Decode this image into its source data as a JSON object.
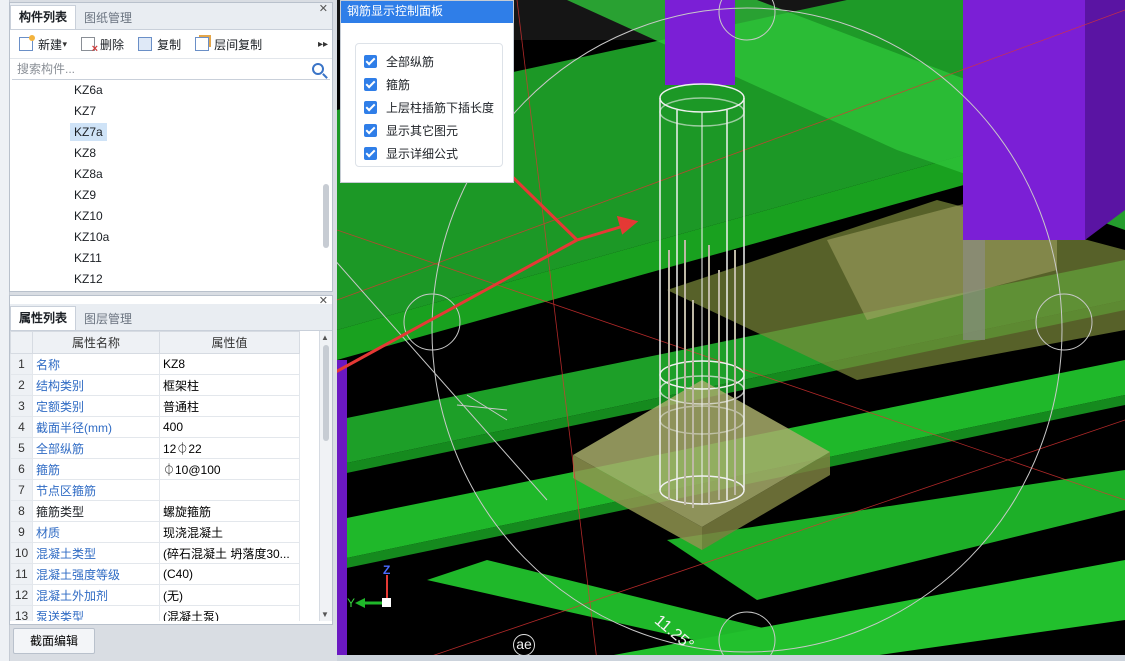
{
  "component_panel": {
    "tabs": [
      "构件列表",
      "图纸管理"
    ],
    "toolbar": {
      "new": "新建",
      "delete": "删除",
      "copy": "复制",
      "floor_copy": "层间复制"
    },
    "search_placeholder": "搜索构件...",
    "items": [
      "KZ6a",
      "KZ7",
      "KZ7a",
      "KZ8",
      "KZ8a",
      "KZ9",
      "KZ10",
      "KZ10a",
      "KZ11",
      "KZ12"
    ],
    "selected_item": "KZ7a"
  },
  "property_panel": {
    "tabs": [
      "属性列表",
      "图层管理"
    ],
    "headers": {
      "name": "属性名称",
      "value": "属性值"
    },
    "rows": [
      {
        "no": "1",
        "name": "名称",
        "value": "KZ8",
        "blue": true
      },
      {
        "no": "2",
        "name": "结构类别",
        "value": "框架柱",
        "blue": true
      },
      {
        "no": "3",
        "name": "定额类别",
        "value": "普通柱",
        "blue": true
      },
      {
        "no": "4",
        "name": "截面半径(mm)",
        "value": "400",
        "blue": true
      },
      {
        "no": "5",
        "name": "全部纵筋",
        "value": "12⏀22",
        "blue": true
      },
      {
        "no": "6",
        "name": "箍筋",
        "value": "⏀10@100",
        "blue": true
      },
      {
        "no": "7",
        "name": "节点区箍筋",
        "value": "",
        "blue": true
      },
      {
        "no": "8",
        "name": "箍筋类型",
        "value": "螺旋箍筋",
        "blue": false
      },
      {
        "no": "9",
        "name": "材质",
        "value": "现浇混凝土",
        "blue": true
      },
      {
        "no": "10",
        "name": "混凝土类型",
        "value": "(碎石混凝土 坍落度30...",
        "blue": true
      },
      {
        "no": "11",
        "name": "混凝土强度等级",
        "value": "(C40)",
        "blue": true
      },
      {
        "no": "12",
        "name": "混凝土外加剂",
        "value": "(无)",
        "blue": true
      },
      {
        "no": "13",
        "name": "泵送类型",
        "value": "(混凝土泵)",
        "blue": true
      }
    ],
    "section_edit_button": "截面编辑"
  },
  "control_panel": {
    "title": "钢筋显示控制面板",
    "options": [
      {
        "label": "全部纵筋",
        "checked": true
      },
      {
        "label": "箍筋",
        "checked": true
      },
      {
        "label": "上层柱插筋下插长度",
        "checked": true
      },
      {
        "label": "显示其它图元",
        "checked": true
      },
      {
        "label": "显示详细公式",
        "checked": true
      }
    ]
  },
  "viewport": {
    "axis_labels": {
      "y": "Y",
      "z": "Z"
    },
    "angle_label": "11.25°",
    "ae_label": "ae"
  },
  "colors": {
    "accent": "#2f7ee8",
    "link_blue": "#2f6bc4",
    "arrow_red": "#e53935",
    "beam_green": "#1fb82a",
    "column_purple": "#7b1fd6"
  }
}
